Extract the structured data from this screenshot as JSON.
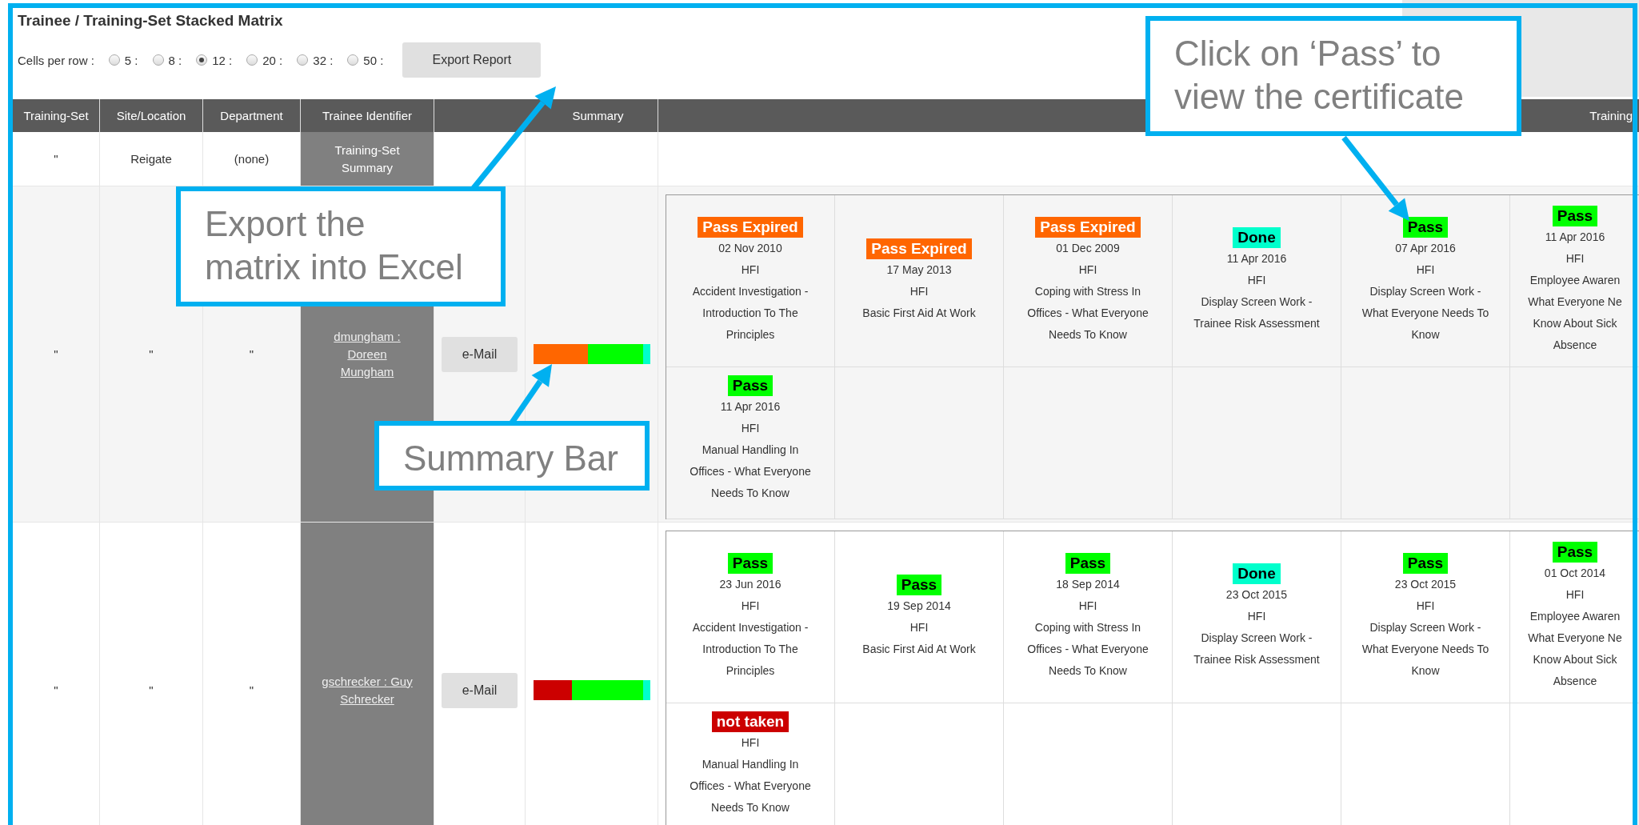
{
  "title": "Trainee / Training-Set Stacked Matrix",
  "cells_per_row": {
    "label": "Cells per row :",
    "options": [
      {
        "label": "5 :",
        "selected": false
      },
      {
        "label": "8 :",
        "selected": false
      },
      {
        "label": "12 :",
        "selected": true
      },
      {
        "label": "20 :",
        "selected": false
      },
      {
        "label": "32 :",
        "selected": false
      },
      {
        "label": "50 :",
        "selected": false
      }
    ]
  },
  "export_button": "Export Report",
  "table": {
    "columns": [
      "Training-Set",
      "Site/Location",
      "Department",
      "Trainee Identifier",
      "Summary",
      "Training"
    ],
    "summary_row": {
      "training_set": "\"",
      "site": "Reigate",
      "department": "(none)",
      "trainee_lines": [
        "Training-Set",
        "Summary"
      ]
    },
    "rows": [
      {
        "training_set": "\"",
        "site": "\"",
        "department": "\"",
        "trainee_lines": [
          "dmungham :",
          "Doreen",
          "Mungham"
        ],
        "email_button": "e-Mail",
        "summary_bar": {
          "color": "#00ffcc",
          "fills": [
            {
              "color": "#ff6600",
              "level": 0.47
            },
            {
              "color": "#00ff00",
              "level": 0.94
            }
          ]
        },
        "results": [
          [
            {
              "status": "Pass Expired",
              "kind": "pass_expired",
              "date": "02 Nov 2010",
              "provider": "HFI",
              "course_lines": [
                "Accident Investigation -",
                "Introduction To The",
                "Principles"
              ]
            },
            {
              "status": "Pass Expired",
              "kind": "pass_expired",
              "date": "17 May 2013",
              "provider": "HFI",
              "course_lines": [
                "Basic First Aid At Work"
              ]
            },
            {
              "status": "Pass Expired",
              "kind": "pass_expired",
              "date": "01 Dec 2009",
              "provider": "HFI",
              "course_lines": [
                "Coping with Stress In",
                "Offices - What Everyone",
                "Needs To Know"
              ]
            },
            {
              "status": "Done",
              "kind": "done",
              "date": "11 Apr 2016",
              "provider": "HFI",
              "course_lines": [
                "Display Screen Work -",
                "Trainee Risk Assessment"
              ]
            },
            {
              "status": "Pass",
              "kind": "pass",
              "date": "07 Apr 2016",
              "provider": "HFI",
              "course_lines": [
                "Display Screen Work -",
                "What Everyone Needs To",
                "Know"
              ]
            },
            {
              "status": "Pass",
              "kind": "pass",
              "date": "11 Apr 2016",
              "provider": "HFI",
              "course_lines": [
                "Employee Awaren",
                "What Everyone Ne",
                "Know About Sick",
                "Absence"
              ]
            }
          ],
          [
            {
              "status": "Pass",
              "kind": "pass",
              "date": "11 Apr 2016",
              "provider": "HFI",
              "course_lines": [
                "Manual Handling In",
                "Offices - What Everyone",
                "Needs To Know"
              ]
            }
          ]
        ]
      },
      {
        "training_set": "\"",
        "site": "\"",
        "department": "\"",
        "trainee_lines": [
          "gschrecker : Guy",
          "Schrecker"
        ],
        "email_button": "e-Mail",
        "summary_bar": {
          "color": "#00ffcc",
          "fills": [
            {
              "color": "#cc0000",
              "level": 0.33
            },
            {
              "color": "#00ff00",
              "level": 0.94
            }
          ]
        },
        "results": [
          [
            {
              "status": "Pass",
              "kind": "pass",
              "date": "23 Jun 2016",
              "provider": "HFI",
              "course_lines": [
                "Accident Investigation -",
                "Introduction To The",
                "Principles"
              ]
            },
            {
              "status": "Pass",
              "kind": "pass",
              "date": "19 Sep 2014",
              "provider": "HFI",
              "course_lines": [
                "Basic First Aid At Work"
              ]
            },
            {
              "status": "Pass",
              "kind": "pass",
              "date": "18 Sep 2014",
              "provider": "HFI",
              "course_lines": [
                "Coping with Stress In",
                "Offices - What Everyone",
                "Needs To Know"
              ]
            },
            {
              "status": "Done",
              "kind": "done",
              "date": "23 Oct 2015",
              "provider": "HFI",
              "course_lines": [
                "Display Screen Work -",
                "Trainee Risk Assessment"
              ]
            },
            {
              "status": "Pass",
              "kind": "pass",
              "date": "23 Oct 2015",
              "provider": "HFI",
              "course_lines": [
                "Display Screen Work -",
                "What Everyone Needs To",
                "Know"
              ]
            },
            {
              "status": "Pass",
              "kind": "pass",
              "date": "01 Oct 2014",
              "provider": "HFI",
              "course_lines": [
                "Employee Awaren",
                "What Everyone Ne",
                "Know About Sick",
                "Absence"
              ]
            }
          ],
          [
            {
              "status": "not taken",
              "kind": "not_taken",
              "provider": "HFI",
              "course_lines": [
                "Manual Handling In",
                "Offices - What Everyone",
                "Needs To Know"
              ]
            }
          ]
        ]
      }
    ]
  },
  "callouts": [
    {
      "lines": [
        "Export the",
        "matrix into Excel"
      ]
    },
    {
      "lines": [
        "Summary Bar"
      ]
    },
    {
      "lines": [
        "Click on ‘Pass’ to",
        "view the certificate"
      ]
    }
  ]
}
